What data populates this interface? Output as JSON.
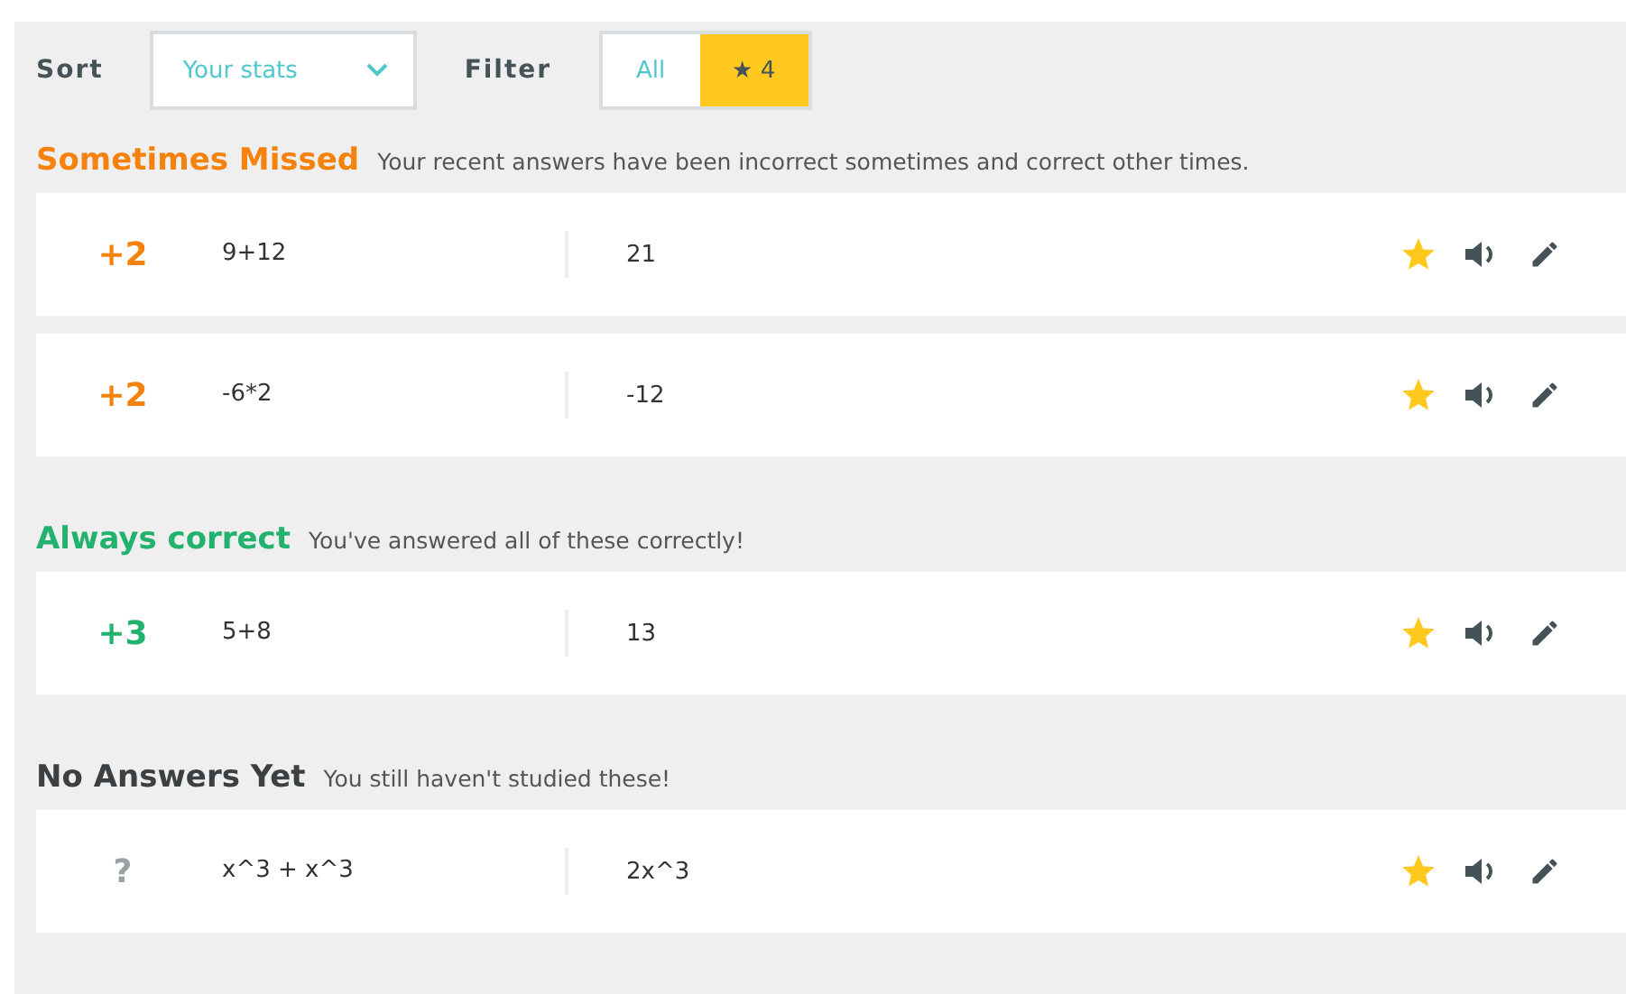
{
  "toolbar": {
    "sort_label": "Sort",
    "sort_value": "Your stats",
    "filter_label": "Filter",
    "filters": [
      {
        "label": "All",
        "selected": false
      },
      {
        "label": "★ 4",
        "selected": true
      }
    ]
  },
  "sections": [
    {
      "title": "Sometimes Missed",
      "description": "Your recent answers have been incorrect sometimes and correct other times.",
      "color": "#f5820d",
      "cards": [
        {
          "score": "+2",
          "term": "9+12",
          "definition": "21",
          "starred": true
        },
        {
          "score": "+2",
          "term": "-6*2",
          "definition": "-12",
          "starred": true
        }
      ]
    },
    {
      "title": "Always correct",
      "description": "You've answered all of these correctly!",
      "color": "#23b26d",
      "cards": [
        {
          "score": "+3",
          "term": "5+8",
          "definition": "13",
          "starred": true
        }
      ]
    },
    {
      "title": "No Answers Yet",
      "description": "You still haven't studied these!",
      "color": "#3c4043",
      "cards": [
        {
          "score": "?",
          "term": "x^3 + x^3",
          "definition": "2x^3",
          "starred": true,
          "unanswered": true
        }
      ]
    }
  ]
}
